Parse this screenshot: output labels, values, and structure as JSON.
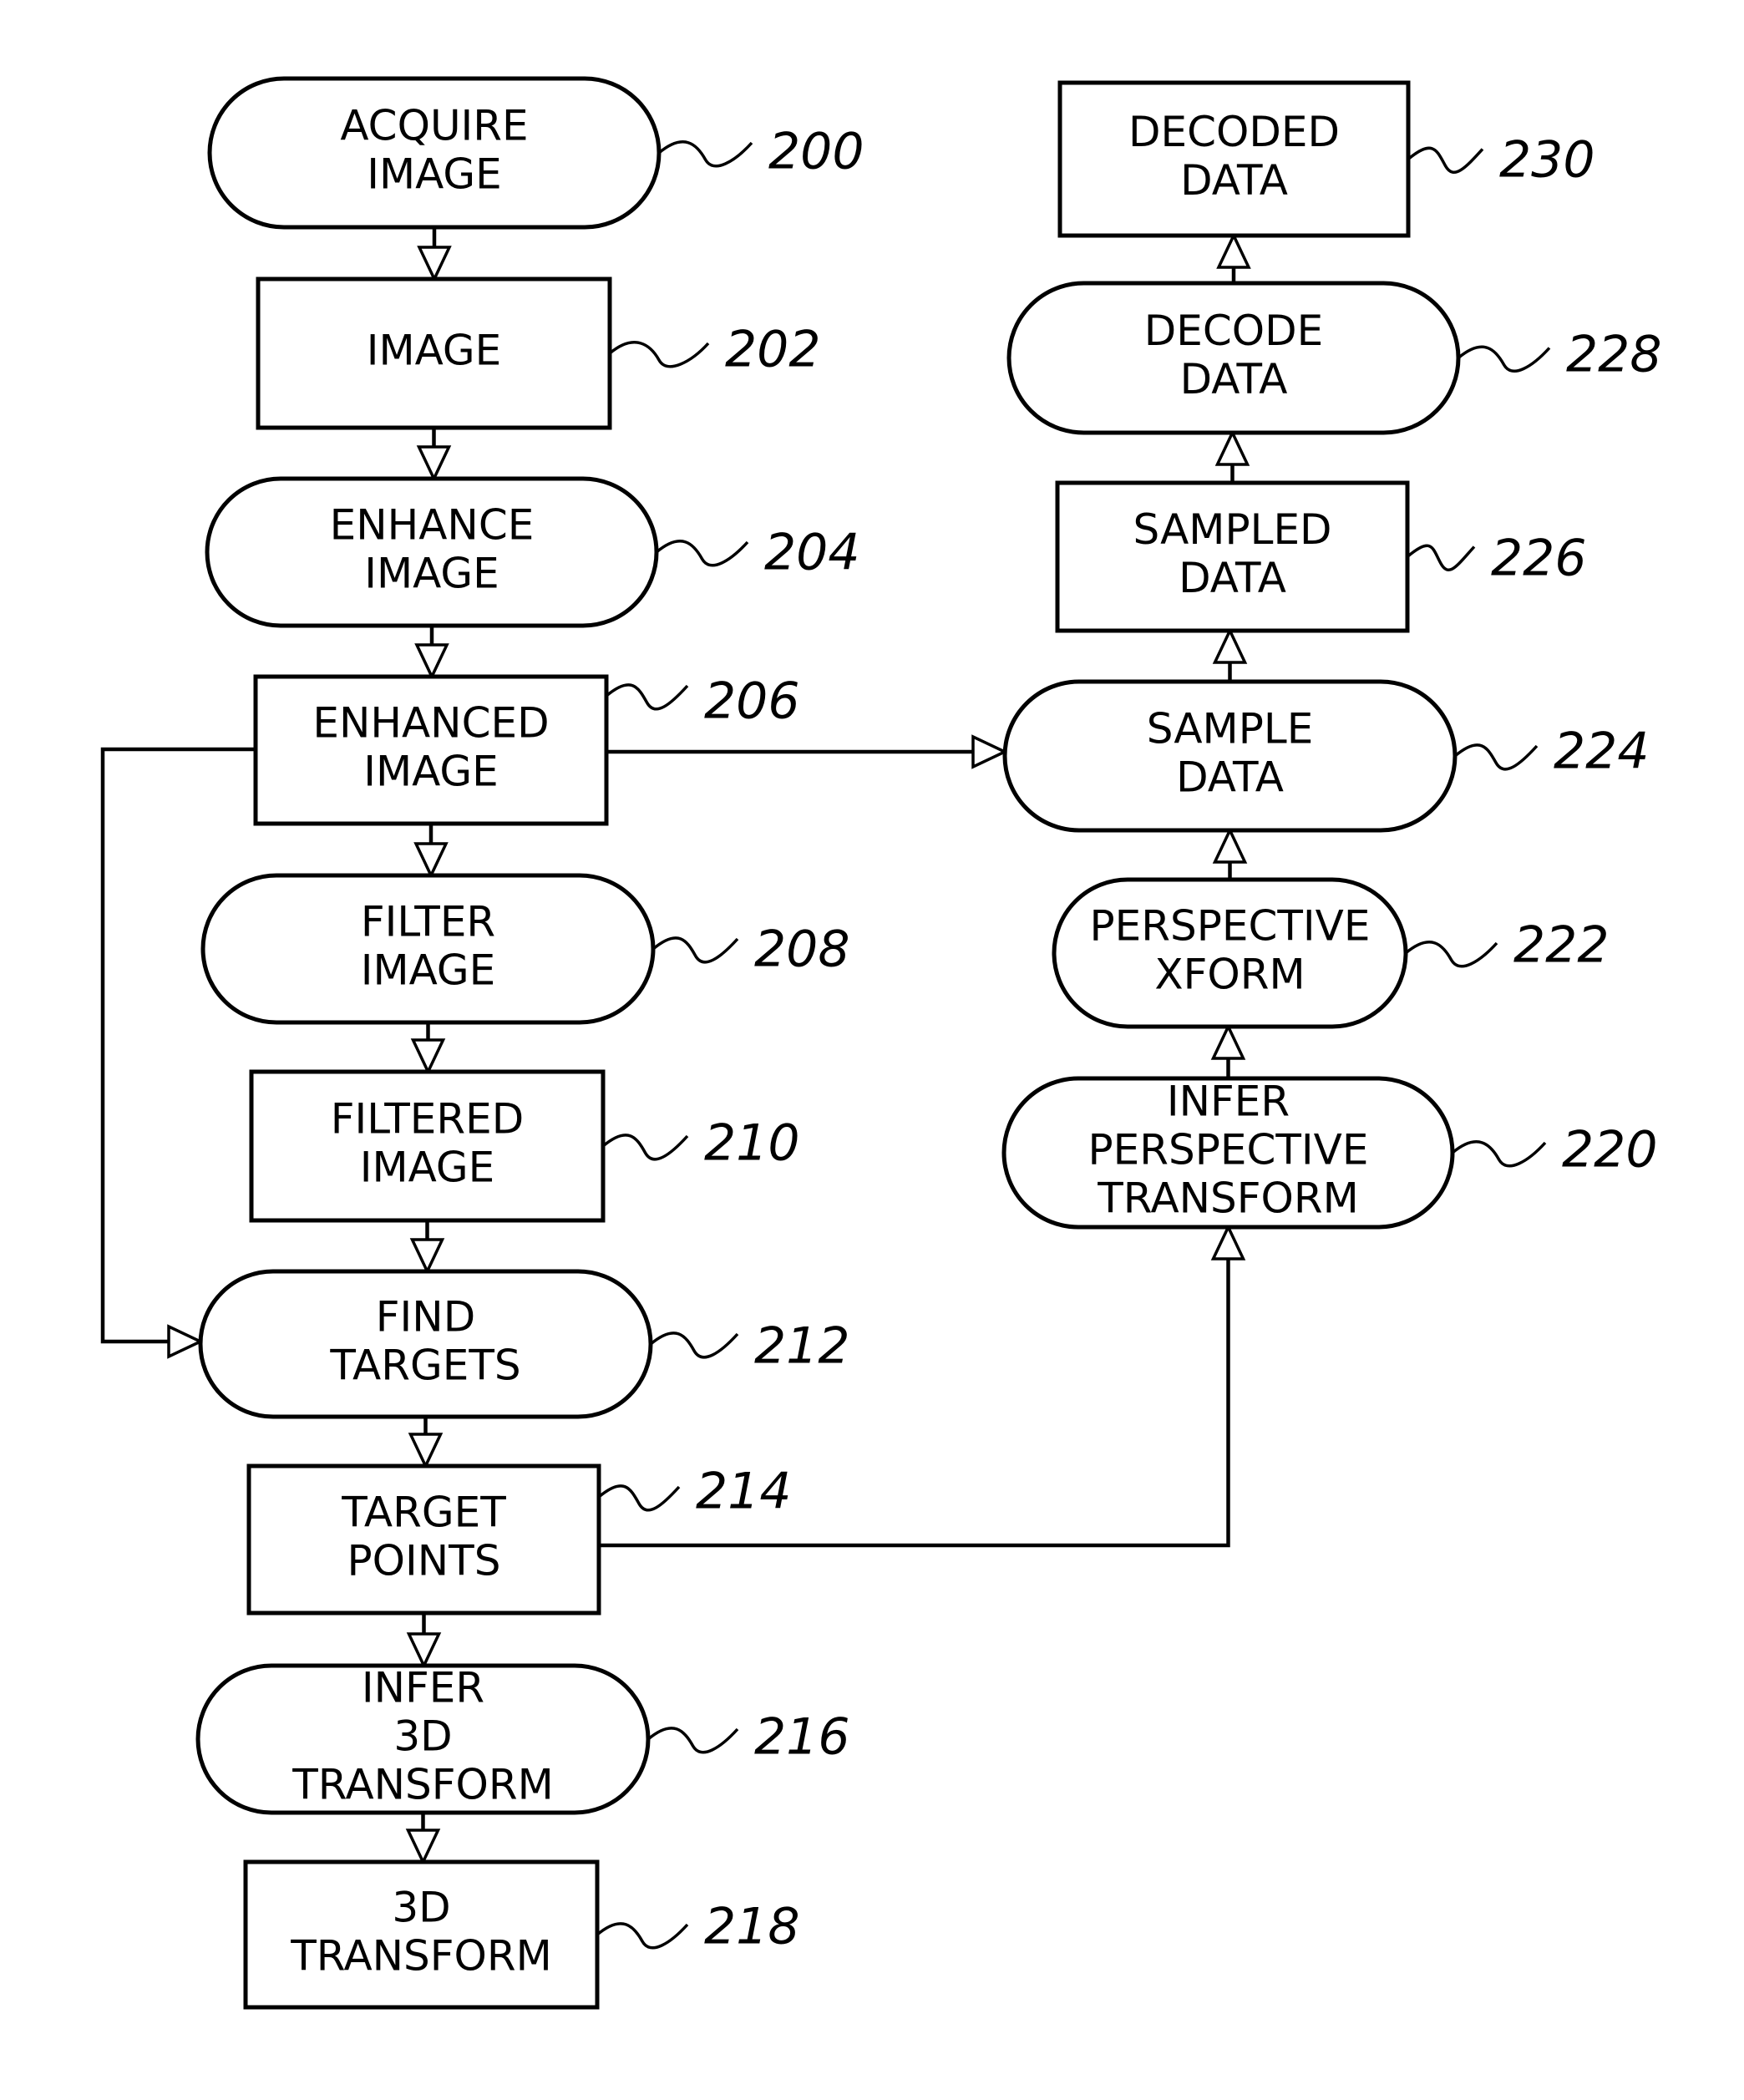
{
  "diagram": {
    "type": "flowchart",
    "nodes": [
      {
        "id": "200",
        "ref": "200",
        "shape": "rounded",
        "lines": [
          "ACQUIRE",
          "IMAGE"
        ]
      },
      {
        "id": "202",
        "ref": "202",
        "shape": "rect",
        "lines": [
          "IMAGE"
        ]
      },
      {
        "id": "204",
        "ref": "204",
        "shape": "rounded",
        "lines": [
          "ENHANCE",
          "IMAGE"
        ]
      },
      {
        "id": "206",
        "ref": "206",
        "shape": "rect",
        "lines": [
          "ENHANCED",
          "IMAGE"
        ]
      },
      {
        "id": "208",
        "ref": "208",
        "shape": "rounded",
        "lines": [
          "FILTER",
          "IMAGE"
        ]
      },
      {
        "id": "210",
        "ref": "210",
        "shape": "rect",
        "lines": [
          "FILTERED",
          "IMAGE"
        ]
      },
      {
        "id": "212",
        "ref": "212",
        "shape": "rounded",
        "lines": [
          "FIND",
          "TARGETS"
        ]
      },
      {
        "id": "214",
        "ref": "214",
        "shape": "rect",
        "lines": [
          "TARGET",
          "POINTS"
        ]
      },
      {
        "id": "216",
        "ref": "216",
        "shape": "rounded",
        "lines": [
          "INFER",
          "3D",
          "TRANSFORM"
        ]
      },
      {
        "id": "218",
        "ref": "218",
        "shape": "rect",
        "lines": [
          "3D",
          "TRANSFORM"
        ]
      },
      {
        "id": "220",
        "ref": "220",
        "shape": "rounded",
        "lines": [
          "INFER",
          "PERSPECTIVE",
          "TRANSFORM"
        ]
      },
      {
        "id": "222",
        "ref": "222",
        "shape": "rounded",
        "lines": [
          "PERSPECTIVE",
          "XFORM"
        ]
      },
      {
        "id": "224",
        "ref": "224",
        "shape": "rounded",
        "lines": [
          "SAMPLE",
          "DATA"
        ]
      },
      {
        "id": "226",
        "ref": "226",
        "shape": "rect",
        "lines": [
          "SAMPLED",
          "DATA"
        ]
      },
      {
        "id": "228",
        "ref": "228",
        "shape": "rounded",
        "lines": [
          "DECODE",
          "DATA"
        ]
      },
      {
        "id": "230",
        "ref": "230",
        "shape": "rect",
        "lines": [
          "DECODED",
          "DATA"
        ]
      }
    ],
    "edges": [
      {
        "from": "200",
        "to": "202"
      },
      {
        "from": "202",
        "to": "204"
      },
      {
        "from": "204",
        "to": "206"
      },
      {
        "from": "206",
        "to": "208"
      },
      {
        "from": "208",
        "to": "210"
      },
      {
        "from": "210",
        "to": "212"
      },
      {
        "from": "206",
        "to": "212"
      },
      {
        "from": "206",
        "to": "224"
      },
      {
        "from": "212",
        "to": "214"
      },
      {
        "from": "214",
        "to": "216"
      },
      {
        "from": "216",
        "to": "218"
      },
      {
        "from": "214",
        "to": "220"
      },
      {
        "from": "220",
        "to": "222"
      },
      {
        "from": "222",
        "to": "224"
      },
      {
        "from": "224",
        "to": "226"
      },
      {
        "from": "226",
        "to": "228"
      },
      {
        "from": "228",
        "to": "230"
      }
    ]
  }
}
